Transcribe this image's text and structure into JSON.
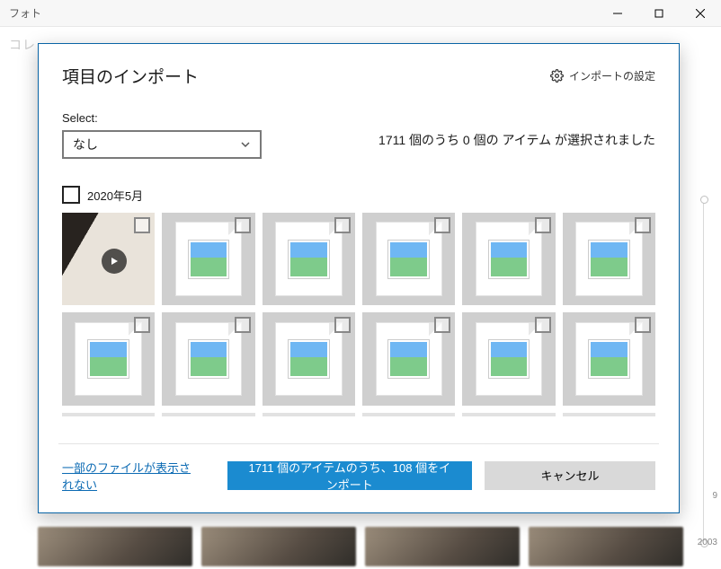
{
  "app_title": "フォト",
  "bg_nav_hint": "コレ",
  "timeline": {
    "top_year": "9",
    "bottom_year": "2003"
  },
  "dialog": {
    "title": "項目のインポート",
    "settings_label": "インポートの設定",
    "select_label": "Select:",
    "select_value": "なし",
    "selection_count": "1711 個のうち 0 個の アイテム が選択されました",
    "group_date": "2020年5月",
    "hidden_files_link": "一部のファイルが表示されない",
    "import_button": "1711 個のアイテムのうち、108 個をインポート",
    "cancel_button": "キャンセル"
  }
}
